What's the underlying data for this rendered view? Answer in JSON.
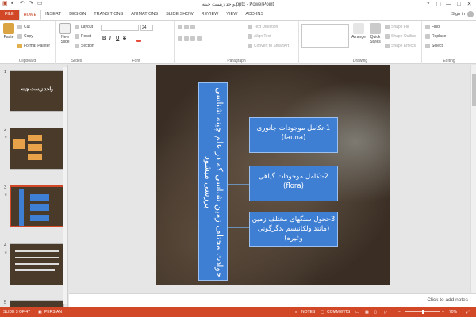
{
  "window": {
    "title": "واحد زیست چینه.pptx - PowerPoint",
    "controls": [
      "?",
      "▢",
      "—",
      "□",
      "✕"
    ]
  },
  "tabs": [
    "FILE",
    "HOME",
    "INSERT",
    "DESIGN",
    "TRANSITIONS",
    "ANIMATIONS",
    "SLIDE SHOW",
    "REVIEW",
    "VIEW",
    "ADD-INS"
  ],
  "signin": "Sign in",
  "ribbon": {
    "clipboard": {
      "paste": "Paste",
      "cut": "Cut",
      "copy": "Copy",
      "format_painter": "Format Painter",
      "label": "Clipboard"
    },
    "slides": {
      "new_slide": "New Slide",
      "layout": "Layout",
      "reset": "Reset",
      "section": "Section",
      "label": "Slides"
    },
    "font": {
      "size": "24",
      "bold": "B",
      "italic": "I",
      "underline": "U",
      "strike": "S",
      "label": "Font"
    },
    "paragraph": {
      "text_direction": "Text Direction",
      "align_text": "Align Text",
      "convert_smartart": "Convert to SmartArt",
      "label": "Paragraph"
    },
    "drawing": {
      "arrange": "Arrange",
      "quick_styles": "Quick Styles",
      "shape_fill": "Shape Fill",
      "shape_outline": "Shape Outline",
      "shape_effects": "Shape Effects",
      "label": "Drawing"
    },
    "editing": {
      "find": "Find",
      "replace": "Replace",
      "select": "Select",
      "label": "Editing"
    }
  },
  "thumbnails": [
    {
      "num": "1",
      "title": "واحد زیست چینه"
    },
    {
      "num": "2",
      "title": ""
    },
    {
      "num": "3",
      "title": ""
    },
    {
      "num": "4",
      "title": ""
    },
    {
      "num": "5",
      "title": ""
    }
  ],
  "slide": {
    "vertical_title": "حوادث مختلف زمین شناسی که در علم چینه شناسی بررسی میشود",
    "boxes": [
      {
        "line1": "1-تکامل موجودات جانوری",
        "line2": "(fauna)"
      },
      {
        "line1": "2-تکامل موجودات گیاهی",
        "line2": "(flora)"
      },
      {
        "line1": "3-تحول سنگهای مختلف زمین",
        "line2": "(مانند ولکانیسم ،دگرگونی وغیره)"
      }
    ]
  },
  "notes_placeholder": "Click to add notes",
  "status": {
    "slide_info": "SLIDE 3 OF 47",
    "language": "PERSIAN",
    "notes": "NOTES",
    "comments": "COMMENTS",
    "zoom": "70%"
  }
}
